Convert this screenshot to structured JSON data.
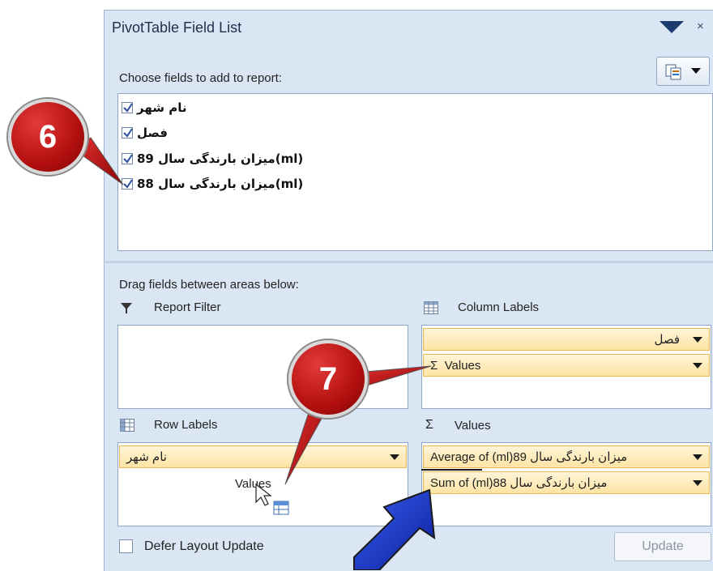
{
  "window": {
    "title": "PivotTable Field List",
    "close_glyph": "×"
  },
  "field_section": {
    "label": "Choose fields to add to report:",
    "fields": [
      {
        "label": "نام شهر",
        "checked": true
      },
      {
        "label": "فصل",
        "checked": true
      },
      {
        "label": "(ml)میزان بارندگی سال 89",
        "checked": true
      },
      {
        "label": "(ml)میزان بارندگی سال 88",
        "checked": true
      }
    ]
  },
  "areas": {
    "label": "Drag fields between areas below:",
    "report_filter": {
      "label": "Report Filter",
      "items": []
    },
    "column_labels": {
      "label": "Column Labels",
      "items": [
        "فصل",
        "Values"
      ],
      "sigma": "Σ"
    },
    "row_labels": {
      "label": "Row Labels",
      "items": [
        "نام شهر"
      ],
      "drag_text": "Values"
    },
    "values": {
      "label": "Values",
      "sigma": "Σ",
      "items": [
        "Average of (ml)میزان بارندگی سال 89",
        "Sum of (ml)میزان بارندگی سال 88"
      ]
    }
  },
  "footer": {
    "defer_label": "Defer Layout Update",
    "update_label": "Update"
  },
  "callouts": {
    "six": "6",
    "seven": "7"
  },
  "colors": {
    "callout_red": "#c41616",
    "item_fill": "#fde3a4",
    "panel_bg": "#dbe6f4",
    "blue_arrow": "#1030c8"
  }
}
